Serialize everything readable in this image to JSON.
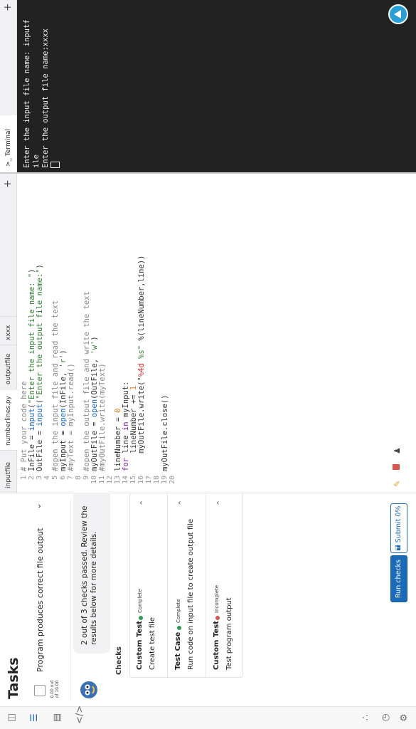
{
  "tasks": {
    "title": "Tasks",
    "task": {
      "label": "Program produces correct file output",
      "score": "0.00 out of 10.00"
    },
    "result": "2 out of 3 checks passed. Review the results below for more details.",
    "checks_title": "Checks",
    "checks": [
      {
        "type": "Custom Test",
        "status": "Complete",
        "status_color": "#2e9b4f",
        "desc": "Create test file"
      },
      {
        "type": "Test Case",
        "status": "Complete",
        "status_color": "#2e9b4f",
        "desc": "Run code on input file to create output file"
      },
      {
        "type": "Custom Test",
        "status": "Incomplete",
        "status_color": "#d9534f",
        "desc": "Test program output"
      }
    ],
    "run_label": "Run checks",
    "submit_label": "Submit 0%"
  },
  "editor": {
    "tabs": [
      "inputfile",
      "numberlines.py",
      "outputfile",
      "xxxx"
    ],
    "active_tab": "numberlines.py"
  },
  "terminal": {
    "tab_label": ">_ Terminal",
    "output": "Enter the input file name: inputf\nile\nEnter the output file name:xxxx\n"
  },
  "colors": {
    "accent": "#1c6bb8",
    "terminal_bg": "#222222",
    "help": "#2a9fd6"
  }
}
